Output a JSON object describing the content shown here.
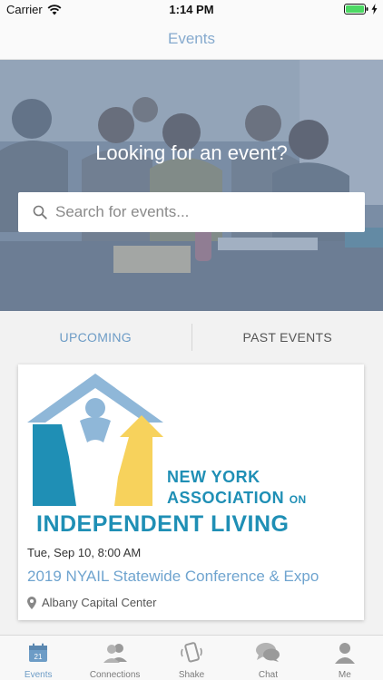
{
  "status_bar": {
    "carrier": "Carrier",
    "time": "1:14 PM"
  },
  "nav": {
    "title": "Events"
  },
  "hero": {
    "heading": "Looking for an event?",
    "search": {
      "placeholder": "Search for events...",
      "value": ""
    }
  },
  "tabs": [
    {
      "label": "UPCOMING",
      "selected": true
    },
    {
      "label": "PAST EVENTS",
      "selected": false
    }
  ],
  "events": [
    {
      "logo": {
        "line1": "NEW YORK",
        "line2": "ASSOCIATION",
        "line2_suffix": "ON",
        "line3": "INDEPENDENT LIVING"
      },
      "date": "Tue, Sep 10, 8:00 AM",
      "title": "2019 NYAIL Statewide Conference & Expo",
      "venue": "Albany Capital Center"
    }
  ],
  "tab_bar": {
    "calendar_day": "21",
    "items": [
      {
        "label": "Events",
        "icon": "calendar-icon",
        "active": true
      },
      {
        "label": "Connections",
        "icon": "people-icon",
        "active": false
      },
      {
        "label": "Shake",
        "icon": "phone-shake-icon",
        "active": false
      },
      {
        "label": "Chat",
        "icon": "chat-bubbles-icon",
        "active": false
      },
      {
        "label": "Me",
        "icon": "person-icon",
        "active": false
      }
    ]
  },
  "colors": {
    "accent": "#6d9cc6",
    "nav_title": "#86aace",
    "logo_blue": "#1f8fb5",
    "logo_yellow": "#f7d25c",
    "logo_light_blue": "#8fb7d8",
    "battery": "#4cd964"
  }
}
